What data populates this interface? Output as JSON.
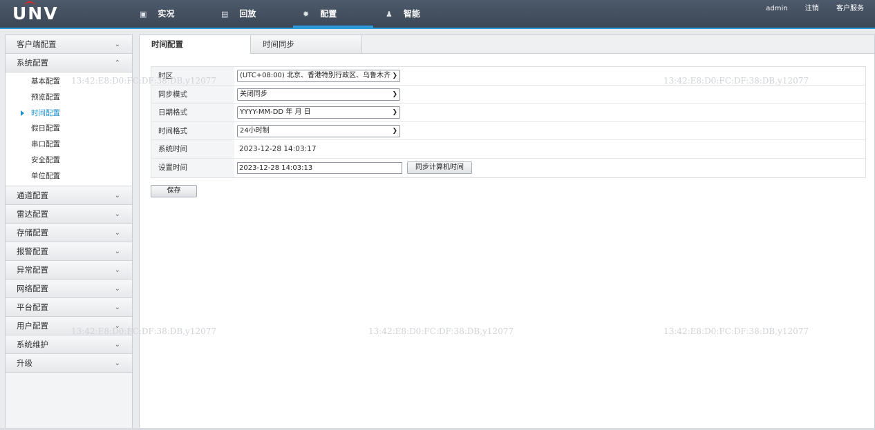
{
  "header": {
    "logo": "UNV",
    "nav": [
      {
        "label": "实况",
        "icon": "monitor-icon"
      },
      {
        "label": "回放",
        "icon": "film-icon"
      },
      {
        "label": "配置",
        "icon": "gear-icon"
      },
      {
        "label": "智能",
        "icon": "person-icon"
      }
    ],
    "user": "admin",
    "logout": "注销",
    "service": "客户服务"
  },
  "sidebar": {
    "groups": [
      {
        "label": "客户端配置"
      },
      {
        "label": "系统配置",
        "expanded": true,
        "items": [
          "基本配置",
          "预览配置",
          "时间配置",
          "假日配置",
          "串口配置",
          "安全配置",
          "单位配置"
        ],
        "selected": "时间配置"
      },
      {
        "label": "通道配置"
      },
      {
        "label": "雷达配置"
      },
      {
        "label": "存储配置"
      },
      {
        "label": "报警配置"
      },
      {
        "label": "异常配置"
      },
      {
        "label": "网络配置"
      },
      {
        "label": "平台配置"
      },
      {
        "label": "用户配置"
      },
      {
        "label": "系统维护"
      },
      {
        "label": "升级"
      }
    ]
  },
  "tabs": [
    "时间配置",
    "时间同步"
  ],
  "form": {
    "timezone_label": "时区",
    "timezone_value": "(UTC+08:00)  北京、香港特别行政区、乌鲁木齐",
    "sync_mode_label": "同步模式",
    "sync_mode_value": "关闭同步",
    "date_format_label": "日期格式",
    "date_format_value": "YYYY-MM-DD 年 月 日",
    "time_format_label": "时间格式",
    "time_format_value": "24小时制",
    "system_time_label": "系统时间",
    "system_time_value": "2023-12-28 14:03:17",
    "set_time_label": "设置时间",
    "set_time_value": "2023-12-28 14:03:13",
    "sync_pc_button": "同步计算机时间",
    "save_button": "保存"
  },
  "watermark": "13:42:E8:D0:FC:DF:38:DB,y12077"
}
